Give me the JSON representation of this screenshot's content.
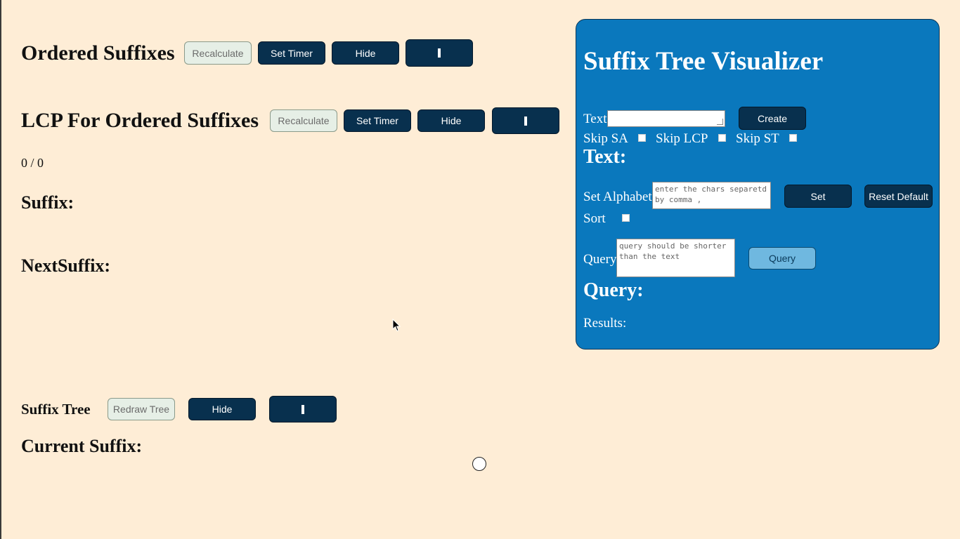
{
  "ordered_suffixes": {
    "title": "Ordered Suffixes",
    "recalc_label": "Recalculate",
    "timer_label": "Set Timer",
    "hide_label": "Hide"
  },
  "lcp": {
    "title": "LCP For Ordered Suffixes",
    "recalc_label": "Recalculate",
    "timer_label": "Set Timer",
    "hide_label": "Hide",
    "counter": "0 / 0"
  },
  "suffix_label": "Suffix:",
  "next_suffix_label": "NextSuffix:",
  "suffix_tree": {
    "title": "Suffix Tree",
    "redraw_label": "Redraw Tree",
    "hide_label": "Hide",
    "current_suffix_label": "Current Suffix:"
  },
  "panel": {
    "title": "Suffix Tree Visualizer",
    "text_label": "Text",
    "text_value": "",
    "create_label": "Create",
    "skip_sa_label": "Skip SA",
    "skip_lcp_label": "Skip LCP",
    "skip_st_label": "Skip ST",
    "text_heading": "Text:",
    "alphabet_label": "Set Alphabet",
    "alphabet_placeholder": "enter the chars separetd by comma ,",
    "set_label": "Set",
    "reset_label": "Reset Default",
    "sort_label": "Sort",
    "query_label": "Query",
    "query_placeholder": "query should be shorter than the text",
    "query_button_label": "Query",
    "query_heading": "Query:",
    "results_label": "Results:"
  },
  "colors": {
    "background": "#feedd6",
    "panel": "#0a78bd",
    "dark_button": "#08304e",
    "light_button": "#e6efe6",
    "query_button": "#6fb8e0"
  },
  "icons": [
    "pause-icon",
    "mouse-pointer-icon",
    "tree-node-circle"
  ]
}
